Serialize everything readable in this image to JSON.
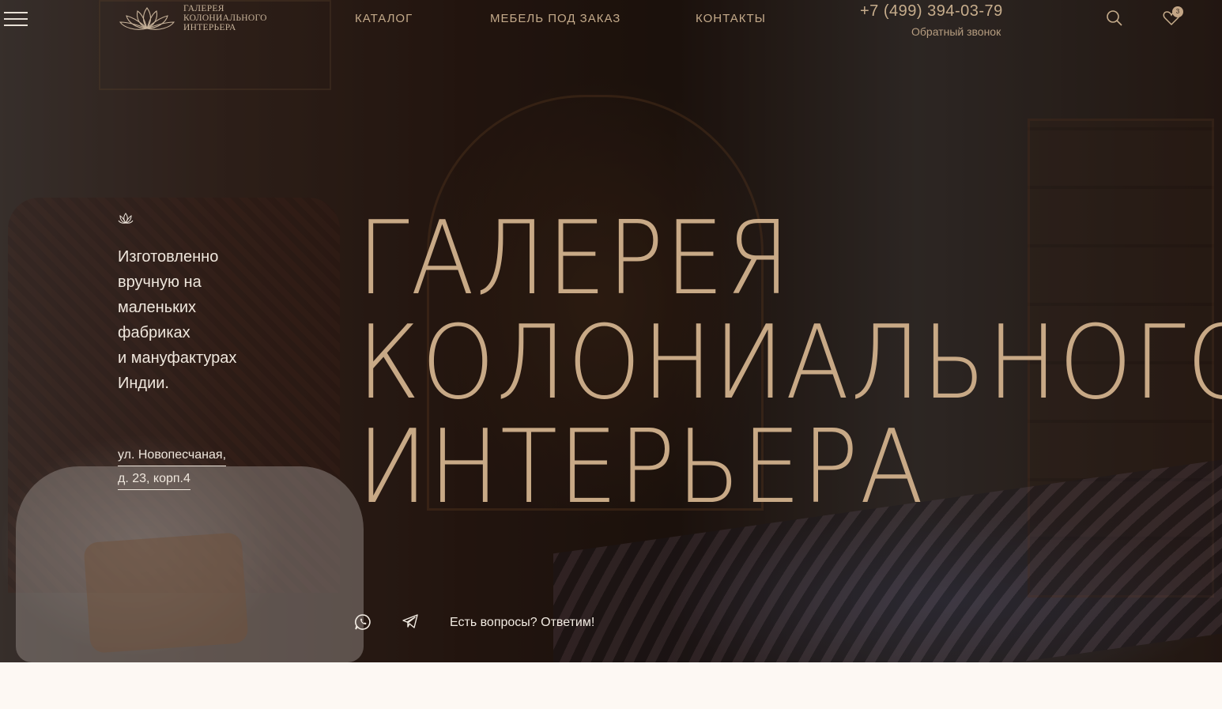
{
  "header": {
    "logo": {
      "lines": [
        "ГАЛЕРЕЯ",
        "КОЛОНИАЛЬНОГО",
        "ИНТЕРЬЕРА"
      ]
    },
    "nav": [
      {
        "label": "КАТАЛОГ"
      },
      {
        "label": "МЕБЕЛЬ ПОД ЗАКАЗ"
      },
      {
        "label": "КОНТАКТЫ"
      }
    ],
    "phone": "+7 (499) 394-03-79",
    "callback": "Обратный звонок",
    "wishlist_count": "3",
    "icons": [
      "menu-icon",
      "search-icon",
      "heart-icon"
    ]
  },
  "hero": {
    "tagline_lines": [
      "Изготовленно",
      "вручную на",
      "маленьких",
      "фабриках",
      "и мануфактурах",
      "Индии."
    ],
    "address_lines": [
      "ул. Новопесчаная,",
      "д. 23, корп.4"
    ],
    "title_lines": [
      "ГАЛЕРЕЯ",
      "КОЛОНИАЛЬНОГО",
      "ИНТЕРЬЕРА"
    ],
    "contact_prompt": "Есть вопросы? Ответим!",
    "social_icons": [
      "whatsapp-icon",
      "telegram-icon"
    ]
  },
  "colors": {
    "accent": "#c8a986",
    "text_light": "#efe7dd",
    "page_bg": "#fdf8f3"
  }
}
